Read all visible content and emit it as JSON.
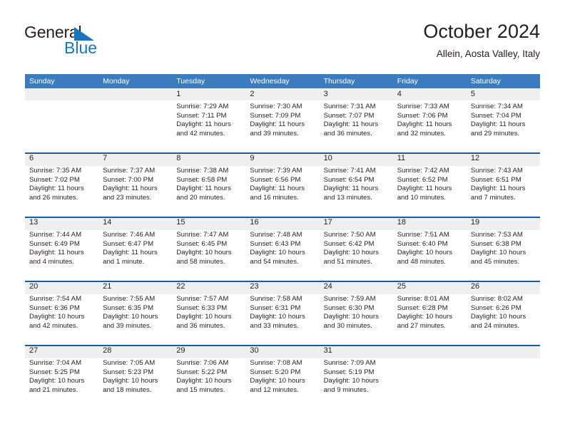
{
  "brand": {
    "line1": "General",
    "line2": "Blue",
    "triangle_color": "#1a76bc"
  },
  "header": {
    "title": "October 2024",
    "subtitle": "Allein, Aosta Valley, Italy"
  },
  "colors": {
    "header_blue": "#3a7cbe",
    "rule_blue": "#1a5c9e",
    "numband_gray": "#efefef",
    "text": "#231f20"
  },
  "weekdays": [
    "Sunday",
    "Monday",
    "Tuesday",
    "Wednesday",
    "Thursday",
    "Friday",
    "Saturday"
  ],
  "weeks": [
    [
      {
        "day": "",
        "sunrise": "",
        "sunset": "",
        "daylight": ""
      },
      {
        "day": "",
        "sunrise": "",
        "sunset": "",
        "daylight": ""
      },
      {
        "day": "1",
        "sunrise": "Sunrise: 7:29 AM",
        "sunset": "Sunset: 7:11 PM",
        "daylight": "Daylight: 11 hours and 42 minutes."
      },
      {
        "day": "2",
        "sunrise": "Sunrise: 7:30 AM",
        "sunset": "Sunset: 7:09 PM",
        "daylight": "Daylight: 11 hours and 39 minutes."
      },
      {
        "day": "3",
        "sunrise": "Sunrise: 7:31 AM",
        "sunset": "Sunset: 7:07 PM",
        "daylight": "Daylight: 11 hours and 36 minutes."
      },
      {
        "day": "4",
        "sunrise": "Sunrise: 7:33 AM",
        "sunset": "Sunset: 7:06 PM",
        "daylight": "Daylight: 11 hours and 32 minutes."
      },
      {
        "day": "5",
        "sunrise": "Sunrise: 7:34 AM",
        "sunset": "Sunset: 7:04 PM",
        "daylight": "Daylight: 11 hours and 29 minutes."
      }
    ],
    [
      {
        "day": "6",
        "sunrise": "Sunrise: 7:35 AM",
        "sunset": "Sunset: 7:02 PM",
        "daylight": "Daylight: 11 hours and 26 minutes."
      },
      {
        "day": "7",
        "sunrise": "Sunrise: 7:37 AM",
        "sunset": "Sunset: 7:00 PM",
        "daylight": "Daylight: 11 hours and 23 minutes."
      },
      {
        "day": "8",
        "sunrise": "Sunrise: 7:38 AM",
        "sunset": "Sunset: 6:58 PM",
        "daylight": "Daylight: 11 hours and 20 minutes."
      },
      {
        "day": "9",
        "sunrise": "Sunrise: 7:39 AM",
        "sunset": "Sunset: 6:56 PM",
        "daylight": "Daylight: 11 hours and 16 minutes."
      },
      {
        "day": "10",
        "sunrise": "Sunrise: 7:41 AM",
        "sunset": "Sunset: 6:54 PM",
        "daylight": "Daylight: 11 hours and 13 minutes."
      },
      {
        "day": "11",
        "sunrise": "Sunrise: 7:42 AM",
        "sunset": "Sunset: 6:52 PM",
        "daylight": "Daylight: 11 hours and 10 minutes."
      },
      {
        "day": "12",
        "sunrise": "Sunrise: 7:43 AM",
        "sunset": "Sunset: 6:51 PM",
        "daylight": "Daylight: 11 hours and 7 minutes."
      }
    ],
    [
      {
        "day": "13",
        "sunrise": "Sunrise: 7:44 AM",
        "sunset": "Sunset: 6:49 PM",
        "daylight": "Daylight: 11 hours and 4 minutes."
      },
      {
        "day": "14",
        "sunrise": "Sunrise: 7:46 AM",
        "sunset": "Sunset: 6:47 PM",
        "daylight": "Daylight: 11 hours and 1 minute."
      },
      {
        "day": "15",
        "sunrise": "Sunrise: 7:47 AM",
        "sunset": "Sunset: 6:45 PM",
        "daylight": "Daylight: 10 hours and 58 minutes."
      },
      {
        "day": "16",
        "sunrise": "Sunrise: 7:48 AM",
        "sunset": "Sunset: 6:43 PM",
        "daylight": "Daylight: 10 hours and 54 minutes."
      },
      {
        "day": "17",
        "sunrise": "Sunrise: 7:50 AM",
        "sunset": "Sunset: 6:42 PM",
        "daylight": "Daylight: 10 hours and 51 minutes."
      },
      {
        "day": "18",
        "sunrise": "Sunrise: 7:51 AM",
        "sunset": "Sunset: 6:40 PM",
        "daylight": "Daylight: 10 hours and 48 minutes."
      },
      {
        "day": "19",
        "sunrise": "Sunrise: 7:53 AM",
        "sunset": "Sunset: 6:38 PM",
        "daylight": "Daylight: 10 hours and 45 minutes."
      }
    ],
    [
      {
        "day": "20",
        "sunrise": "Sunrise: 7:54 AM",
        "sunset": "Sunset: 6:36 PM",
        "daylight": "Daylight: 10 hours and 42 minutes."
      },
      {
        "day": "21",
        "sunrise": "Sunrise: 7:55 AM",
        "sunset": "Sunset: 6:35 PM",
        "daylight": "Daylight: 10 hours and 39 minutes."
      },
      {
        "day": "22",
        "sunrise": "Sunrise: 7:57 AM",
        "sunset": "Sunset: 6:33 PM",
        "daylight": "Daylight: 10 hours and 36 minutes."
      },
      {
        "day": "23",
        "sunrise": "Sunrise: 7:58 AM",
        "sunset": "Sunset: 6:31 PM",
        "daylight": "Daylight: 10 hours and 33 minutes."
      },
      {
        "day": "24",
        "sunrise": "Sunrise: 7:59 AM",
        "sunset": "Sunset: 6:30 PM",
        "daylight": "Daylight: 10 hours and 30 minutes."
      },
      {
        "day": "25",
        "sunrise": "Sunrise: 8:01 AM",
        "sunset": "Sunset: 6:28 PM",
        "daylight": "Daylight: 10 hours and 27 minutes."
      },
      {
        "day": "26",
        "sunrise": "Sunrise: 8:02 AM",
        "sunset": "Sunset: 6:26 PM",
        "daylight": "Daylight: 10 hours and 24 minutes."
      }
    ],
    [
      {
        "day": "27",
        "sunrise": "Sunrise: 7:04 AM",
        "sunset": "Sunset: 5:25 PM",
        "daylight": "Daylight: 10 hours and 21 minutes."
      },
      {
        "day": "28",
        "sunrise": "Sunrise: 7:05 AM",
        "sunset": "Sunset: 5:23 PM",
        "daylight": "Daylight: 10 hours and 18 minutes."
      },
      {
        "day": "29",
        "sunrise": "Sunrise: 7:06 AM",
        "sunset": "Sunset: 5:22 PM",
        "daylight": "Daylight: 10 hours and 15 minutes."
      },
      {
        "day": "30",
        "sunrise": "Sunrise: 7:08 AM",
        "sunset": "Sunset: 5:20 PM",
        "daylight": "Daylight: 10 hours and 12 minutes."
      },
      {
        "day": "31",
        "sunrise": "Sunrise: 7:09 AM",
        "sunset": "Sunset: 5:19 PM",
        "daylight": "Daylight: 10 hours and 9 minutes."
      },
      {
        "day": "",
        "sunrise": "",
        "sunset": "",
        "daylight": ""
      },
      {
        "day": "",
        "sunrise": "",
        "sunset": "",
        "daylight": ""
      }
    ]
  ]
}
